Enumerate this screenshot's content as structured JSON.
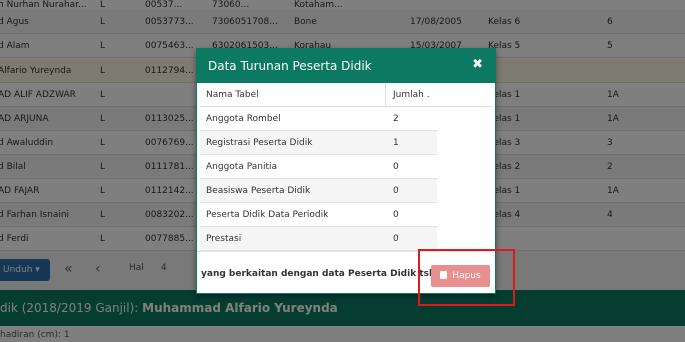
{
  "background": {
    "rows": [
      {
        "name": "h Nurhan Nurahar...",
        "jk": "L",
        "nisn": "00537...",
        "nik": "73060...",
        "tempat": "Kotaham...",
        "tgl": "",
        "kelas": "",
        "tingkat": ""
      },
      {
        "name": "d Agus",
        "jk": "L",
        "nisn": "0053773...",
        "nik": "7306051708...",
        "tempat": "Bone",
        "tgl": "17/08/2005",
        "kelas": "Kelas 6",
        "tingkat": "6"
      },
      {
        "name": "d Alam",
        "jk": "L",
        "nisn": "0075463...",
        "nik": "6302061503...",
        "tempat": "Korahau",
        "tgl": "15/03/2007",
        "kelas": "Kelas 5",
        "tingkat": "5"
      },
      {
        "name": "Alfario Yureynda",
        "jk": "L",
        "nisn": "0112794...",
        "nik": "",
        "tempat": "",
        "tgl": "",
        "kelas": "",
        "tingkat": ""
      },
      {
        "name": "AD ALIF ADZWAR",
        "jk": "L",
        "nisn": "",
        "nik": "",
        "tempat": "",
        "tgl": "",
        "kelas": "Kelas 1",
        "tingkat": "1A"
      },
      {
        "name": "AD ARJUNA",
        "jk": "L",
        "nisn": "0113025...",
        "nik": "",
        "tempat": "",
        "tgl": "",
        "kelas": "Kelas 1",
        "tingkat": "1A"
      },
      {
        "name": "d Awaluddin",
        "jk": "L",
        "nisn": "0076769...",
        "nik": "",
        "tempat": "",
        "tgl": "",
        "kelas": "Kelas 3",
        "tingkat": "3"
      },
      {
        "name": "d Bilal",
        "jk": "L",
        "nisn": "0111781...",
        "nik": "",
        "tempat": "",
        "tgl": "",
        "kelas": "Kelas 2",
        "tingkat": "2"
      },
      {
        "name": "AD FAJAR",
        "jk": "L",
        "nisn": "0112142...",
        "nik": "",
        "tempat": "",
        "tgl": "",
        "kelas": "Kelas 1",
        "tingkat": "1A"
      },
      {
        "name": "d Farhan Isnaini",
        "jk": "L",
        "nisn": "0083202...",
        "nik": "",
        "tempat": "",
        "tgl": "",
        "kelas": "Kelas 4",
        "tingkat": "4"
      },
      {
        "name": "d Ferdi",
        "jk": "L",
        "nisn": "0077885...",
        "nik": "",
        "tempat": "",
        "tgl": "",
        "kelas": "",
        "tingkat": ""
      }
    ],
    "toolbar": {
      "unduh_label": "Unduh ▾",
      "first_icon": "«",
      "prev_icon": "‹",
      "hal_label": "Hal",
      "page_value": "4"
    },
    "section_title_prefix": "dik (2018/2019 Ganjil): ",
    "section_title_name": "Muhammad Alfario Yureynda",
    "sub_label": "hadiran (cm): 1"
  },
  "modal": {
    "title": "Data Turunan Peserta Didik",
    "close_icon": "✖",
    "columns": {
      "name": "Nama Tabel",
      "count": "Jumlah ."
    },
    "rows": [
      {
        "name": "Anggota Rombel",
        "count": "2"
      },
      {
        "name": "Registrasi Peserta Didik",
        "count": "1"
      },
      {
        "name": "Anggota Panitia",
        "count": "0"
      },
      {
        "name": "Beasiswa Peserta Didik",
        "count": "0"
      },
      {
        "name": "Peserta Didik Data Periodik",
        "count": "0"
      },
      {
        "name": "Prestasi",
        "count": "0"
      }
    ],
    "footer_message": "yang berkaitan dengan data Peserta Didik tsb",
    "delete_button_label": "Hapus",
    "delete_icon": "trash-icon"
  },
  "colors": {
    "accent": "#0c7a63",
    "danger_button": "#e88f8f",
    "highlight_box": "#e0191c"
  }
}
